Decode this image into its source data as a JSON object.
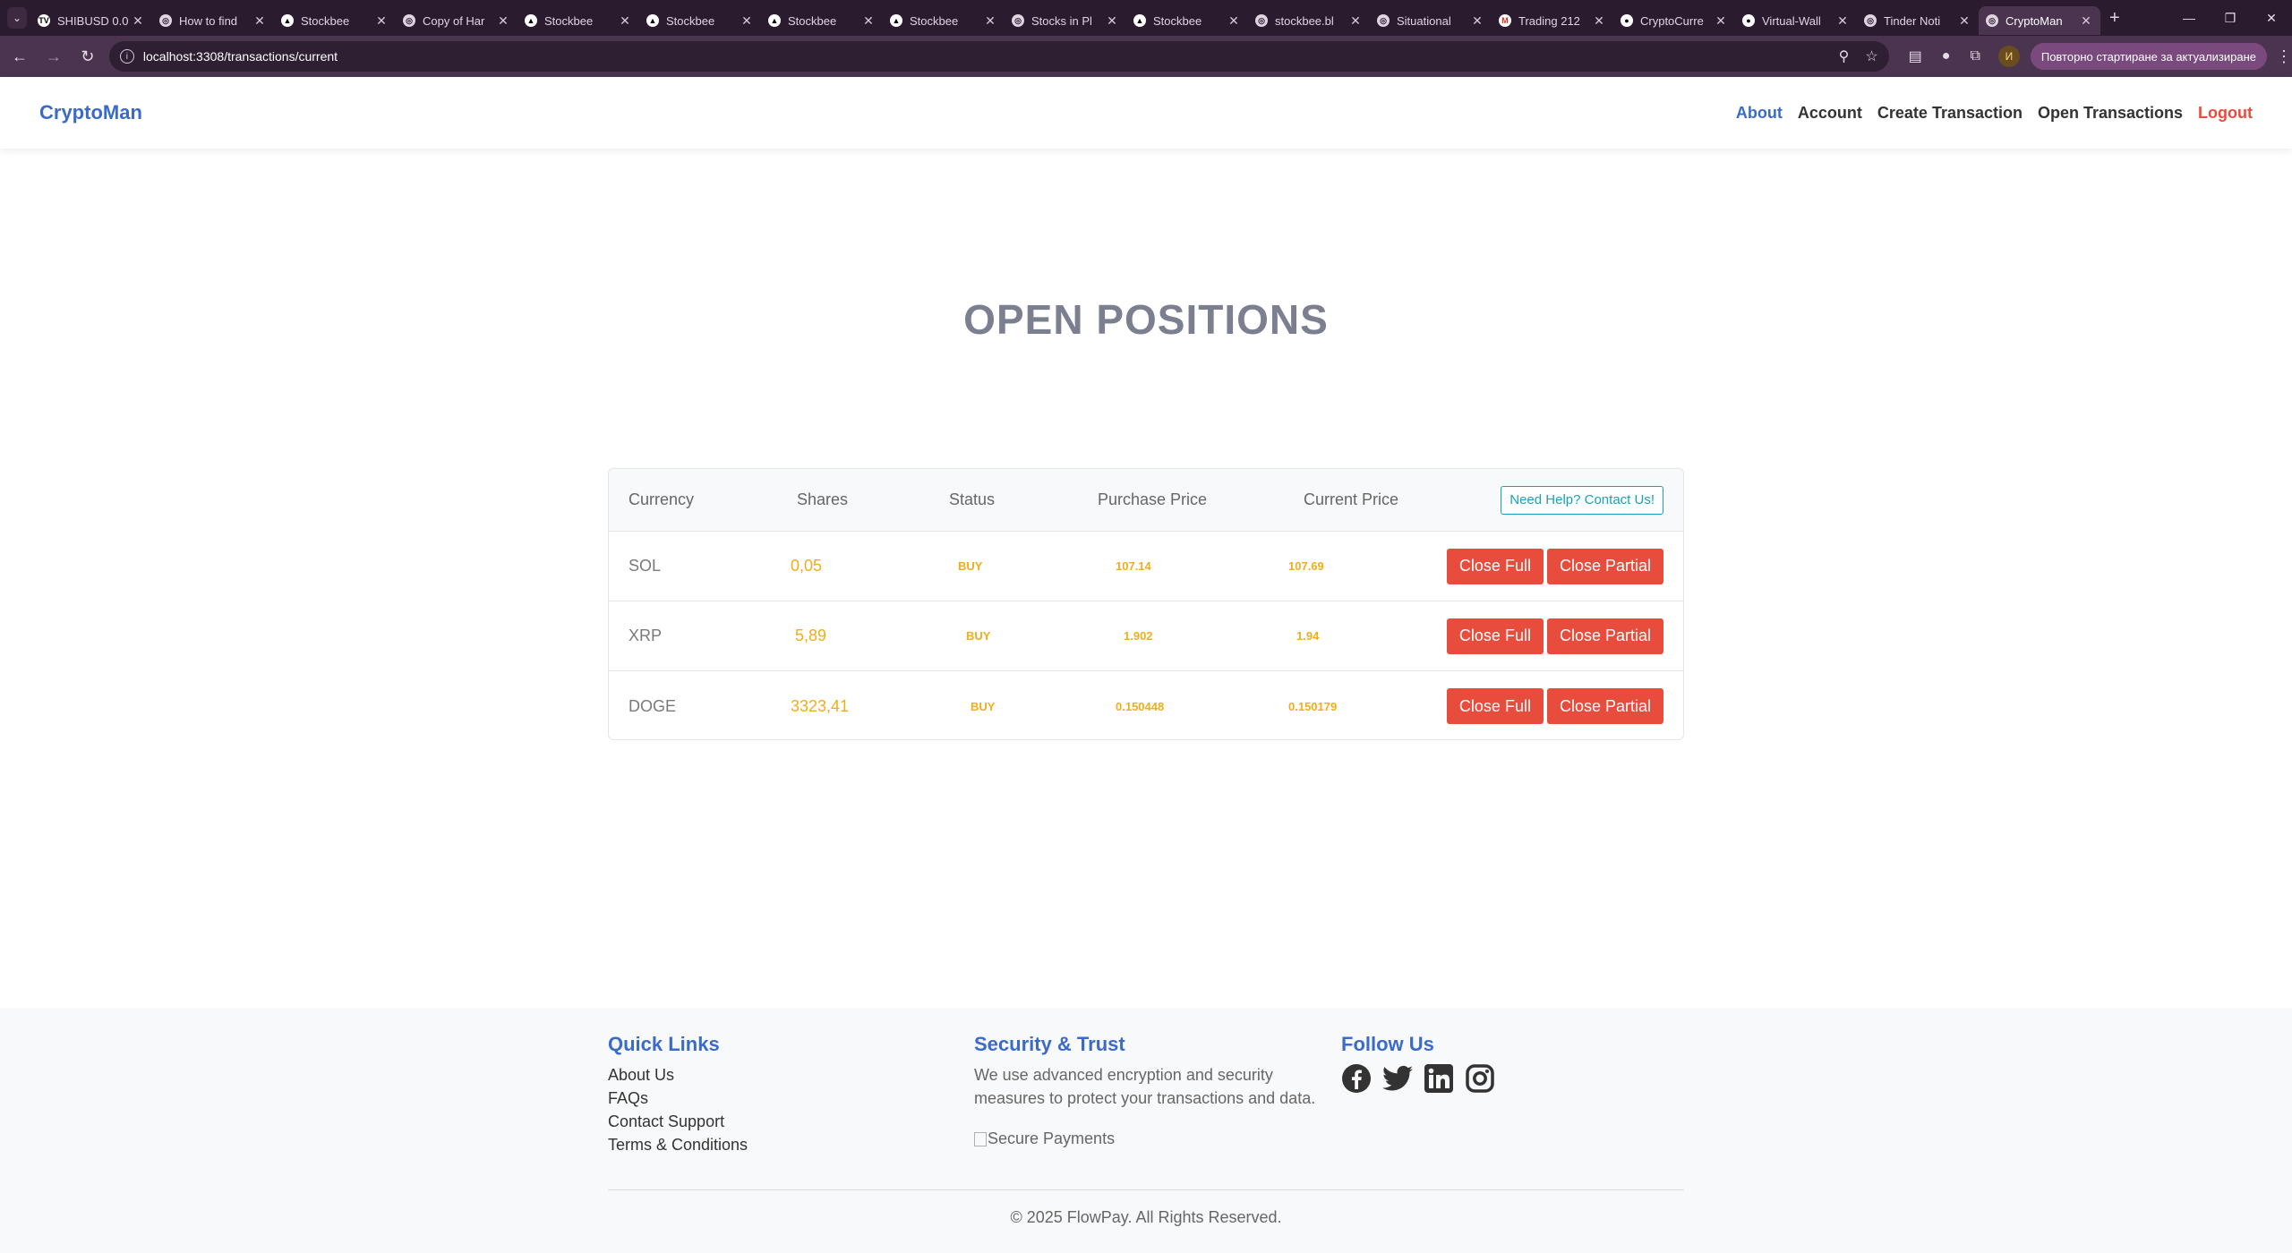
{
  "browser": {
    "tabs": [
      {
        "title": "SHIBUSD 0.0",
        "fav_color": "#ffffff",
        "fav_glyph": "TV",
        "fav_text": "#000000"
      },
      {
        "title": "How to find",
        "fav_color": "#e0d3e2",
        "fav_glyph": "◎",
        "fav_text": "#2b1b2e"
      },
      {
        "title": "Stockbee",
        "fav_color": "#ffffff",
        "fav_glyph": "▲",
        "fav_text": "#000000"
      },
      {
        "title": "Copy of Har",
        "fav_color": "#e0d3e2",
        "fav_glyph": "◎",
        "fav_text": "#2b1b2e"
      },
      {
        "title": "Stockbee",
        "fav_color": "#ffffff",
        "fav_glyph": "▲",
        "fav_text": "#000000"
      },
      {
        "title": "Stockbee",
        "fav_color": "#ffffff",
        "fav_glyph": "▲",
        "fav_text": "#000000"
      },
      {
        "title": "Stockbee",
        "fav_color": "#ffffff",
        "fav_glyph": "▲",
        "fav_text": "#000000"
      },
      {
        "title": "Stockbee",
        "fav_color": "#ffffff",
        "fav_glyph": "▲",
        "fav_text": "#000000"
      },
      {
        "title": "Stocks in Pl",
        "fav_color": "#e0d3e2",
        "fav_glyph": "◎",
        "fav_text": "#2b1b2e"
      },
      {
        "title": "Stockbee",
        "fav_color": "#ffffff",
        "fav_glyph": "▲",
        "fav_text": "#000000"
      },
      {
        "title": "stockbee.bl",
        "fav_color": "#e0d3e2",
        "fav_glyph": "◎",
        "fav_text": "#2b1b2e"
      },
      {
        "title": "Situational",
        "fav_color": "#e0d3e2",
        "fav_glyph": "◎",
        "fav_text": "#2b1b2e"
      },
      {
        "title": "Trading 212",
        "fav_color": "#ffffff",
        "fav_glyph": "M",
        "fav_text": "#d93025"
      },
      {
        "title": "CryptoCurre",
        "fav_color": "#ffffff",
        "fav_glyph": "●",
        "fav_text": "#000000"
      },
      {
        "title": "Virtual-Wall",
        "fav_color": "#ffffff",
        "fav_glyph": "●",
        "fav_text": "#000000"
      },
      {
        "title": "Tinder Noti",
        "fav_color": "#e0d3e2",
        "fav_glyph": "◎",
        "fav_text": "#2b1b2e"
      },
      {
        "title": "CryptoMan",
        "fav_color": "#e0d3e2",
        "fav_glyph": "◎",
        "fav_text": "#2b1b2e",
        "active": true
      }
    ],
    "url": "localhost:3308/transactions/current",
    "update_button": "Повторно стартиране за актуализиране",
    "profile_initial": "И"
  },
  "site": {
    "brand": "CryptoMan",
    "nav": {
      "about": "About",
      "account": "Account",
      "create_transaction": "Create Transaction",
      "open_transactions": "Open Transactions",
      "logout": "Logout"
    }
  },
  "main": {
    "title": "OPEN POSITIONS",
    "table": {
      "headers": {
        "currency": "Currency",
        "shares": "Shares",
        "status": "Status",
        "purchase_price": "Purchase Price",
        "current_price": "Current Price"
      },
      "help_button": "Need Help? Contact Us!",
      "rows": [
        {
          "currency": "SOL",
          "shares": "0,05",
          "status": "BUY",
          "purchase_price": "107.14",
          "current_price": "107.69",
          "close_full": "Close Full",
          "close_partial": "Close Partial"
        },
        {
          "currency": "XRP",
          "shares": "5,89",
          "status": "BUY",
          "purchase_price": "1.902",
          "current_price": "1.94",
          "close_full": "Close Full",
          "close_partial": "Close Partial"
        },
        {
          "currency": "DOGE",
          "shares": "3323,41",
          "status": "BUY",
          "purchase_price": "0.150448",
          "current_price": "0.150179",
          "close_full": "Close Full",
          "close_partial": "Close Partial"
        }
      ]
    }
  },
  "footer": {
    "quick_links": {
      "title": "Quick Links",
      "links": [
        "About Us",
        "FAQs",
        "Contact Support",
        "Terms & Conditions"
      ]
    },
    "security": {
      "title": "Security & Trust",
      "text": "We use advanced encryption and security measures to protect your transactions and data.",
      "image_alt": "Secure Payments"
    },
    "follow": {
      "title": "Follow Us",
      "icons": [
        "facebook-icon",
        "twitter-icon",
        "linkedin-icon",
        "instagram-icon"
      ]
    },
    "copyright": "© 2025 FlowPay. All Rights Reserved."
  },
  "colors": {
    "brand": "#3a6bc9",
    "danger": "#e74c3c",
    "warning_text": "#f0ad1c",
    "info": "#17a2b8",
    "chrome_dark": "#2b1b2e",
    "chrome_toolbar": "#4a3450"
  }
}
